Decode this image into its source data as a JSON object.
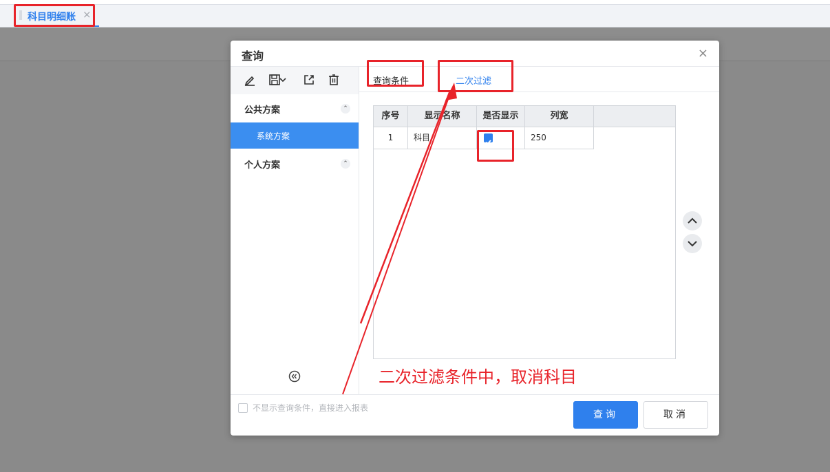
{
  "app": {
    "tab_label": "科目明细账",
    "tab_close": "×"
  },
  "dialog": {
    "title": "查询",
    "close_glyph": "×",
    "toolbar": {
      "icons": [
        "edit-icon",
        "save-icon",
        "chevron-down-icon",
        "export-icon",
        "delete-icon"
      ]
    },
    "groups": [
      {
        "label": "公共方案",
        "toggle": "⌃",
        "items": [
          "系统方案"
        ]
      },
      {
        "label": "个人方案",
        "toggle": "⌃",
        "items": []
      }
    ],
    "tabs": [
      {
        "label": "查询条件",
        "active": false
      },
      {
        "label": "二次过滤",
        "active": true
      }
    ],
    "grid": {
      "columns": [
        "序号",
        "显示名称",
        "是否显示",
        "列宽"
      ],
      "rows": [
        {
          "index": "1",
          "name": "科目",
          "visible": true,
          "width": "250"
        }
      ]
    },
    "skip_label": "不显示查询条件，直接进入报表",
    "query_button": "查询",
    "cancel_button": "取消"
  },
  "annotation": {
    "text": "二次过滤条件中，取消科目",
    "color": "#e8232a"
  },
  "colors": {
    "accent": "#2f80ed",
    "selected_item": "#3b8ef0",
    "overlay": "#8a8a8a"
  }
}
